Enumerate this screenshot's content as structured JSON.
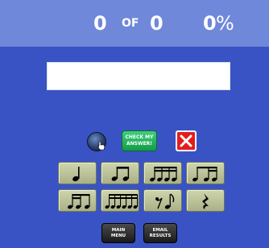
{
  "score": {
    "correct": "0",
    "of_label": "OF",
    "total": "0",
    "percent": "0",
    "percent_sign": "%"
  },
  "controls": {
    "check_line1": "CHECK MY",
    "check_line2": "ANSWER!"
  },
  "rhythm_buttons": [
    {
      "icon": "quarter-note"
    },
    {
      "icon": "two-eighth-notes"
    },
    {
      "icon": "four-sixteenth-notes"
    },
    {
      "icon": "eighth-two-sixteenths"
    },
    {
      "icon": "two-sixteenths-eighth"
    },
    {
      "icon": "six-sixteenth-notes"
    },
    {
      "icon": "eighth-rest-eighth-note"
    },
    {
      "icon": "quarter-rest"
    }
  ],
  "footer": {
    "main_menu_line1": "MAIN",
    "main_menu_line2": "MENU",
    "email_line1": "EMAIL",
    "email_line2": "RESULTS"
  },
  "colors": {
    "background": "#3a53c4",
    "topbar": "#6f88d9",
    "check_button": "#1fb55c",
    "close_button": "#e31d1d",
    "rhythm_button": "#bfc59e"
  }
}
